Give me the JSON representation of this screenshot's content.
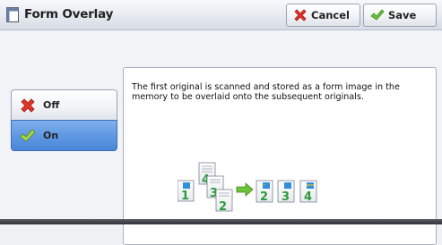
{
  "header": {
    "title": "Form Overlay",
    "cancel_label": "Cancel",
    "save_label": "Save"
  },
  "options": [
    {
      "label": "Off",
      "icon": "red-x-icon",
      "selected": false
    },
    {
      "label": "On",
      "icon": "green-check-icon",
      "selected": true
    }
  ],
  "description": "The first original is scanned and stored as a form image in the memory to be overlaid onto the subsequent originals.",
  "diagram": {
    "form_page": "1",
    "input_pages": [
      "4",
      "3",
      "2"
    ],
    "output_pages": [
      "2",
      "3",
      "4"
    ]
  },
  "colors": {
    "selected": "#5d97e2",
    "cancel_icon": "#e0352b",
    "save_icon": "#5cb82e",
    "page_number": "#2a9a3a"
  }
}
